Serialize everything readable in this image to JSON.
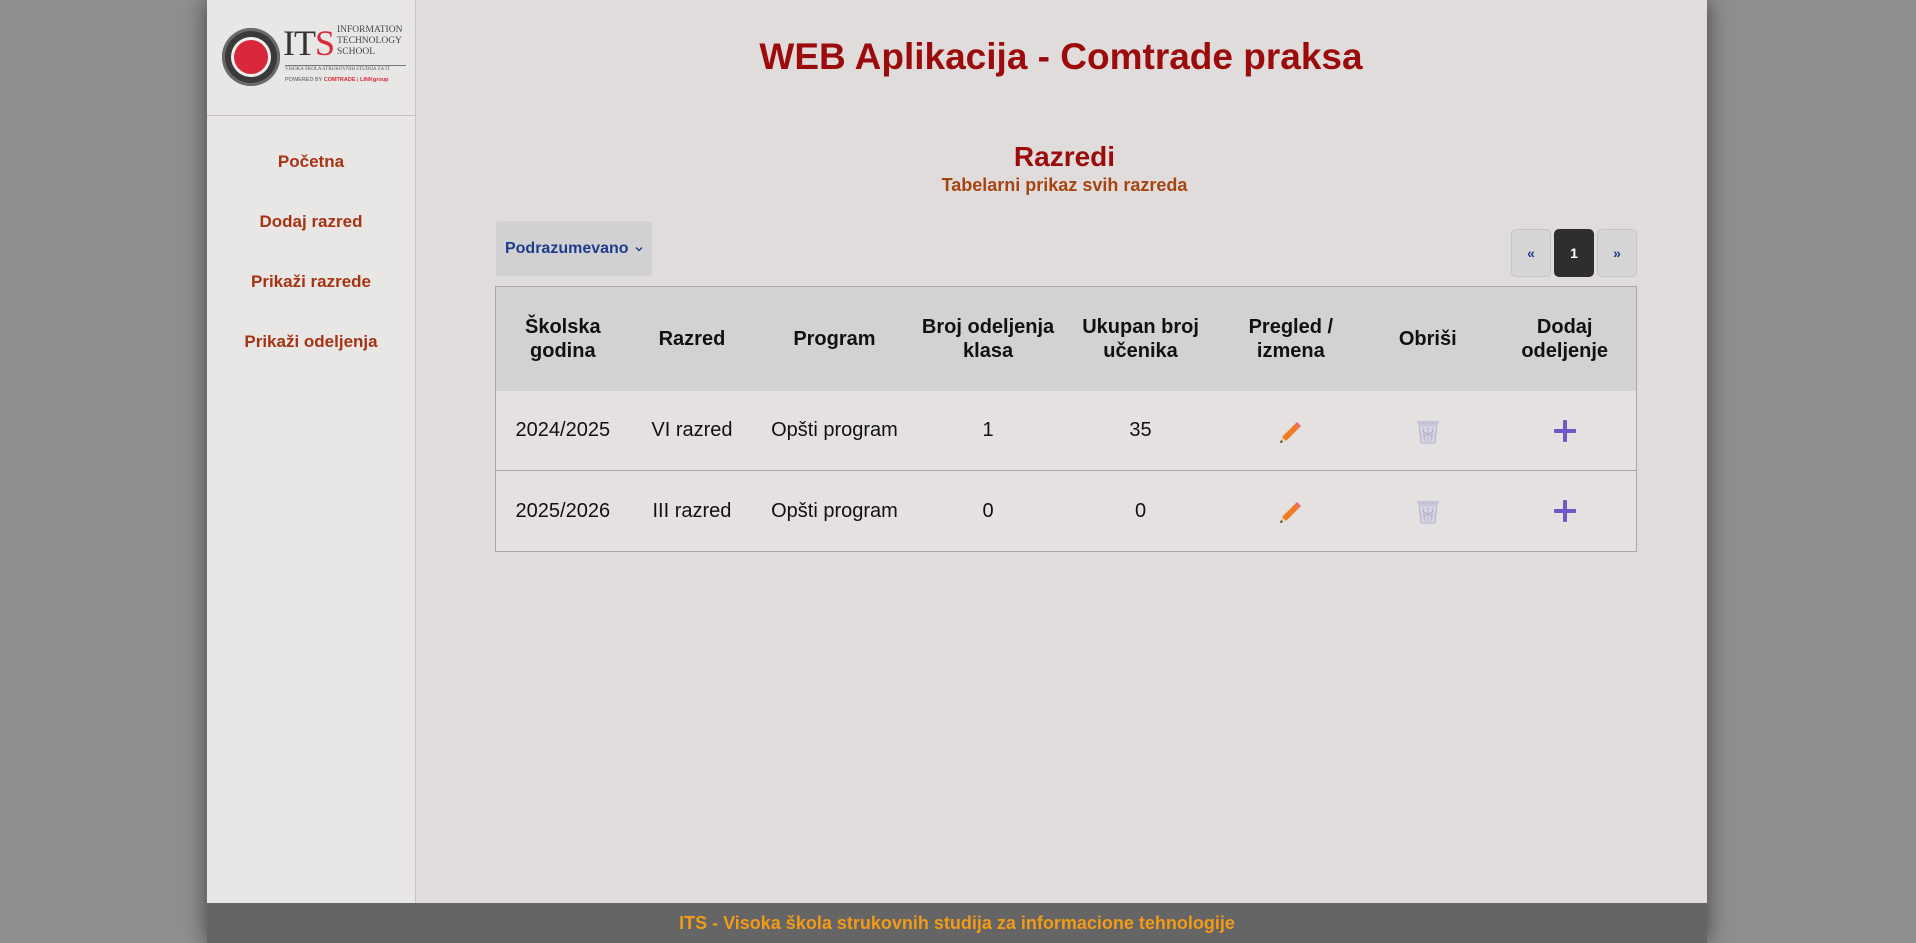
{
  "logo": {
    "brand": "ITS",
    "brand_lines": [
      "INFORMATION",
      "TECHNOLOGY",
      "SCHOOL"
    ],
    "tagline": "VISOKA ŠKOLA STRUKOVNIH STUDIJA ZA IT",
    "powered": "POWERED BY",
    "partner1": "COMTRADE",
    "partner2": "LINKgroup"
  },
  "nav": {
    "items": [
      {
        "label": "Početna"
      },
      {
        "label": "Dodaj razred"
      },
      {
        "label": "Prikaži razrede"
      },
      {
        "label": "Prikaži odeljenja"
      }
    ]
  },
  "header": {
    "title": "WEB Aplikacija - Comtrade praksa"
  },
  "section": {
    "title": "Razredi",
    "subtitle": "Tabelarni prikaz svih razreda"
  },
  "sort": {
    "label": "Podrazumevano",
    "icon": "chevron-down-icon"
  },
  "pagination": {
    "prev": "«",
    "current": "1",
    "next": "»"
  },
  "table": {
    "headers": [
      "Školska godina",
      "Razred",
      "Program",
      "Broj odeljenja klasa",
      "Ukupan broj učenika",
      "Pregled / izmena",
      "Obriši",
      "Dodaj odeljenje"
    ],
    "rows": [
      {
        "year": "2024/2025",
        "grade": "VI razred",
        "program": "Opšti program",
        "sections": "1",
        "students": "35"
      },
      {
        "year": "2025/2026",
        "grade": "III razred",
        "program": "Opšti program",
        "sections": "0",
        "students": "0"
      }
    ]
  },
  "colors": {
    "title": "#9c0b0b",
    "nav": "#a63314",
    "edit_icon": "#f07a25",
    "delete_icon": "#bdbdd0",
    "add_icon": "#6f57c5",
    "footer_text": "#f29b16"
  },
  "footer": {
    "text": "ITS - Visoka škola strukovnih studija za informacione tehnologije"
  }
}
